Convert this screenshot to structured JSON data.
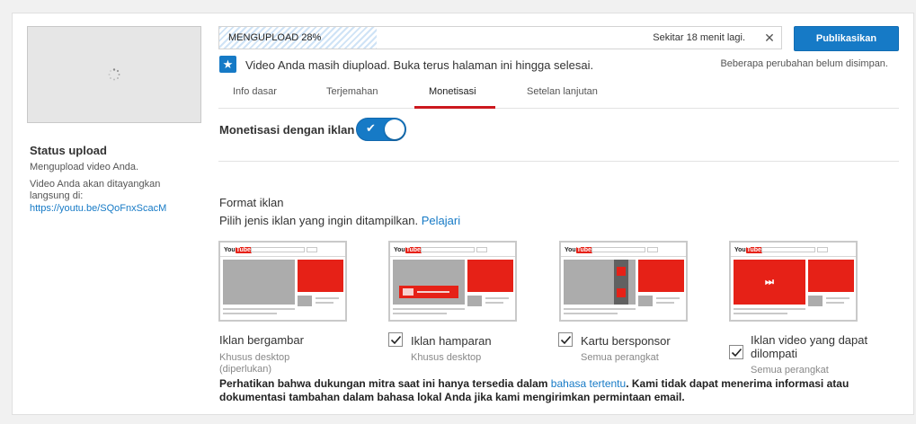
{
  "sidebar": {
    "status_title": "Status upload",
    "status_text": "Mengupload video Anda.",
    "live_text_1": "Video Anda akan ditayangkan",
    "live_text_2": "langsung di:",
    "video_link": "https://youtu.be/SQoFnxScacM"
  },
  "upload": {
    "progress_label": "MENGUPLOAD 28%",
    "progress_fraction": 0.28,
    "time_remaining": "Sekitar 18 menit lagi.",
    "close_icon": "close-icon",
    "publish_label": "Publikasikan",
    "message": "Video Anda masih diupload. Buka terus halaman ini hingga selesai.",
    "unsaved_notice": "Beberapa perubahan belum disimpan."
  },
  "tabs": [
    {
      "label": "Info dasar"
    },
    {
      "label": "Terjemahan"
    },
    {
      "label": "Monetisasi",
      "active": true
    },
    {
      "label": "Setelan lanjutan"
    }
  ],
  "monetization": {
    "label": "Monetisasi dengan iklan",
    "enabled": true
  },
  "ad_formats": {
    "title": "Format iklan",
    "subtitle": "Pilih jenis iklan yang ingin ditampilkan.",
    "learn_link": "Pelajari",
    "items": [
      {
        "name": "Iklan bergambar",
        "note": "Khusus desktop",
        "note2": "(diperlukan)",
        "checkbox": false
      },
      {
        "name": "Iklan hamparan",
        "note": "Khusus desktop",
        "checkbox": true,
        "checked": true
      },
      {
        "name": "Kartu bersponsor",
        "note": "Semua perangkat",
        "checkbox": true,
        "checked": true
      },
      {
        "name": "Iklan video yang dapat",
        "name2": "dilompati",
        "note": "Semua perangkat",
        "checkbox": true,
        "checked": true
      }
    ],
    "logo_text": "You",
    "logo_text_red": "Tube"
  },
  "notice": {
    "part1": "Perhatikan bahwa dukungan mitra saat ini hanya tersedia dalam",
    "link": "bahasa tertentu",
    "part2": ". Kami tidak dapat menerima informasi atau dokumentasi tambahan dalam bahasa lokal Anda jika kami mengirimkan permintaan email."
  },
  "colors": {
    "accent": "#167ac6",
    "brand_red": "#e62117",
    "tab_underline": "#cc181e"
  }
}
